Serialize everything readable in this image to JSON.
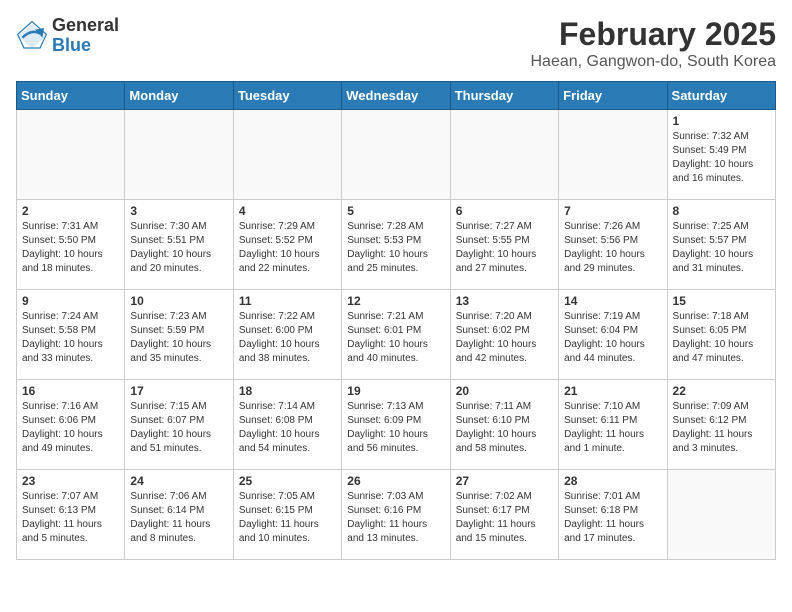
{
  "header": {
    "logo_general": "General",
    "logo_blue": "Blue",
    "month": "February 2025",
    "location": "Haean, Gangwon-do, South Korea"
  },
  "days_of_week": [
    "Sunday",
    "Monday",
    "Tuesday",
    "Wednesday",
    "Thursday",
    "Friday",
    "Saturday"
  ],
  "weeks": [
    [
      {
        "day": "",
        "info": ""
      },
      {
        "day": "",
        "info": ""
      },
      {
        "day": "",
        "info": ""
      },
      {
        "day": "",
        "info": ""
      },
      {
        "day": "",
        "info": ""
      },
      {
        "day": "",
        "info": ""
      },
      {
        "day": "1",
        "info": "Sunrise: 7:32 AM\nSunset: 5:49 PM\nDaylight: 10 hours\nand 16 minutes."
      }
    ],
    [
      {
        "day": "2",
        "info": "Sunrise: 7:31 AM\nSunset: 5:50 PM\nDaylight: 10 hours\nand 18 minutes."
      },
      {
        "day": "3",
        "info": "Sunrise: 7:30 AM\nSunset: 5:51 PM\nDaylight: 10 hours\nand 20 minutes."
      },
      {
        "day": "4",
        "info": "Sunrise: 7:29 AM\nSunset: 5:52 PM\nDaylight: 10 hours\nand 22 minutes."
      },
      {
        "day": "5",
        "info": "Sunrise: 7:28 AM\nSunset: 5:53 PM\nDaylight: 10 hours\nand 25 minutes."
      },
      {
        "day": "6",
        "info": "Sunrise: 7:27 AM\nSunset: 5:55 PM\nDaylight: 10 hours\nand 27 minutes."
      },
      {
        "day": "7",
        "info": "Sunrise: 7:26 AM\nSunset: 5:56 PM\nDaylight: 10 hours\nand 29 minutes."
      },
      {
        "day": "8",
        "info": "Sunrise: 7:25 AM\nSunset: 5:57 PM\nDaylight: 10 hours\nand 31 minutes."
      }
    ],
    [
      {
        "day": "9",
        "info": "Sunrise: 7:24 AM\nSunset: 5:58 PM\nDaylight: 10 hours\nand 33 minutes."
      },
      {
        "day": "10",
        "info": "Sunrise: 7:23 AM\nSunset: 5:59 PM\nDaylight: 10 hours\nand 35 minutes."
      },
      {
        "day": "11",
        "info": "Sunrise: 7:22 AM\nSunset: 6:00 PM\nDaylight: 10 hours\nand 38 minutes."
      },
      {
        "day": "12",
        "info": "Sunrise: 7:21 AM\nSunset: 6:01 PM\nDaylight: 10 hours\nand 40 minutes."
      },
      {
        "day": "13",
        "info": "Sunrise: 7:20 AM\nSunset: 6:02 PM\nDaylight: 10 hours\nand 42 minutes."
      },
      {
        "day": "14",
        "info": "Sunrise: 7:19 AM\nSunset: 6:04 PM\nDaylight: 10 hours\nand 44 minutes."
      },
      {
        "day": "15",
        "info": "Sunrise: 7:18 AM\nSunset: 6:05 PM\nDaylight: 10 hours\nand 47 minutes."
      }
    ],
    [
      {
        "day": "16",
        "info": "Sunrise: 7:16 AM\nSunset: 6:06 PM\nDaylight: 10 hours\nand 49 minutes."
      },
      {
        "day": "17",
        "info": "Sunrise: 7:15 AM\nSunset: 6:07 PM\nDaylight: 10 hours\nand 51 minutes."
      },
      {
        "day": "18",
        "info": "Sunrise: 7:14 AM\nSunset: 6:08 PM\nDaylight: 10 hours\nand 54 minutes."
      },
      {
        "day": "19",
        "info": "Sunrise: 7:13 AM\nSunset: 6:09 PM\nDaylight: 10 hours\nand 56 minutes."
      },
      {
        "day": "20",
        "info": "Sunrise: 7:11 AM\nSunset: 6:10 PM\nDaylight: 10 hours\nand 58 minutes."
      },
      {
        "day": "21",
        "info": "Sunrise: 7:10 AM\nSunset: 6:11 PM\nDaylight: 11 hours\nand 1 minute."
      },
      {
        "day": "22",
        "info": "Sunrise: 7:09 AM\nSunset: 6:12 PM\nDaylight: 11 hours\nand 3 minutes."
      }
    ],
    [
      {
        "day": "23",
        "info": "Sunrise: 7:07 AM\nSunset: 6:13 PM\nDaylight: 11 hours\nand 5 minutes."
      },
      {
        "day": "24",
        "info": "Sunrise: 7:06 AM\nSunset: 6:14 PM\nDaylight: 11 hours\nand 8 minutes."
      },
      {
        "day": "25",
        "info": "Sunrise: 7:05 AM\nSunset: 6:15 PM\nDaylight: 11 hours\nand 10 minutes."
      },
      {
        "day": "26",
        "info": "Sunrise: 7:03 AM\nSunset: 6:16 PM\nDaylight: 11 hours\nand 13 minutes."
      },
      {
        "day": "27",
        "info": "Sunrise: 7:02 AM\nSunset: 6:17 PM\nDaylight: 11 hours\nand 15 minutes."
      },
      {
        "day": "28",
        "info": "Sunrise: 7:01 AM\nSunset: 6:18 PM\nDaylight: 11 hours\nand 17 minutes."
      },
      {
        "day": "",
        "info": ""
      }
    ]
  ]
}
